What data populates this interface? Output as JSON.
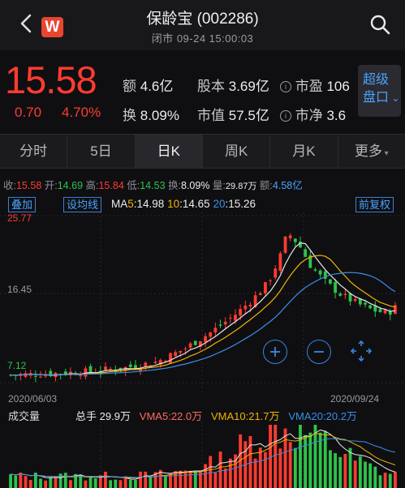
{
  "header": {
    "title": "保龄宝 (002286)",
    "status": "闭市 09-24 15:00:03",
    "logo_text": "W"
  },
  "quote": {
    "price": "15.58",
    "change": "0.70",
    "change_pct": "4.70%",
    "amount_label": "额",
    "amount": "4.6亿",
    "shares_label": "股本",
    "shares": "3.69亿",
    "pe_label": "市盈",
    "pe": "106",
    "turnover_label": "换",
    "turnover": "8.09%",
    "mktcap_label": "市值",
    "mktcap": "57.5亿",
    "pb_label": "市净",
    "pb": "3.6",
    "super_btn_line1": "超级",
    "super_btn_line2": "盘口"
  },
  "tabs": [
    "分时",
    "5日",
    "日K",
    "周K",
    "月K",
    "更多"
  ],
  "active_tab": "日K",
  "info_row": {
    "close_label": "收:",
    "close": "15.58",
    "open_label": "开:",
    "open": "14.69",
    "high_label": "高:",
    "high": "15.84",
    "low_label": "低:",
    "low": "14.53",
    "turn_label": "换:",
    "turn": "8.09%",
    "vol_label": "量:",
    "vol": "29.87万",
    "amt_label": "额:",
    "amt": "4.58亿"
  },
  "chart_controls": {
    "overlay_btn": "叠加",
    "ma_btn": "设均线",
    "ma_label": "MA",
    "ma5_key": "5:",
    "ma5": "14.98",
    "ma10_key": "10:",
    "ma10": "14.65",
    "ma20_key": "20:",
    "ma20": "15.26",
    "adjust_btn": "前复权"
  },
  "axis": {
    "y_top": "25.77",
    "y_mid": "16.45",
    "y_low": "7.12",
    "x_start": "2020/06/03",
    "x_end": "2020/09/24"
  },
  "volume": {
    "title": "成交量",
    "total_label": "总手",
    "total": "29.9万",
    "vma5_label": "VMA5:",
    "vma5": "22.0万",
    "vma10_label": "VMA10:",
    "vma10": "21.7万",
    "vma20_label": "VMA20:",
    "vma20": "20.2万"
  },
  "colors": {
    "up": "#ff3b30",
    "down": "#2ec34a",
    "ma5": "#e8e8e8",
    "ma10": "#f0b400",
    "ma20": "#3a8ee8",
    "accent": "#4aa3ff",
    "logo": "#e8452f"
  },
  "icons": [
    "back-chevron-icon",
    "search-icon",
    "zoom-in-icon",
    "zoom-out-icon",
    "fullscreen-icon",
    "chevron-down-icon",
    "info-icon"
  ]
}
